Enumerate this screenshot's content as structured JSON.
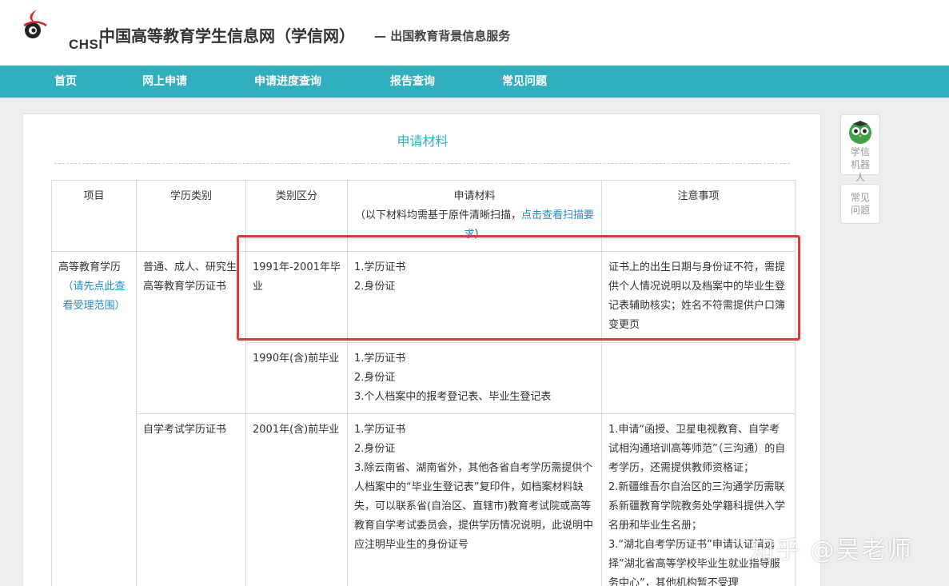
{
  "header": {
    "logo_text": "CHSI",
    "site_title": "中国高等教育学生信息网（学信网）",
    "site_subtitle": "— 出国教育背景信息服务"
  },
  "nav": {
    "items": [
      "首页",
      "网上申请",
      "申请进度查询",
      "报告查询",
      "常见问题"
    ]
  },
  "panel": {
    "title": "申请材料"
  },
  "table": {
    "headers": {
      "project": "项目",
      "category": "学历类别",
      "division": "类别区分",
      "materials": "申请材料",
      "materials_note_prefix": "（以下材料均需基于原件清晰扫描，",
      "materials_note_link": "点击查看扫描要求",
      "materials_note_suffix": "）",
      "notes": "注意事项"
    },
    "project_name": "高等教育学历",
    "project_link": "（请先点此查看受理范围）",
    "rows": [
      {
        "category": "普通、成人、研究生高等教育学历证书",
        "division": "1991年-2001年毕业",
        "materials": [
          "1.学历证书",
          "2.身份证"
        ],
        "notes": "证书上的出生日期与身份证不符，需提供个人情况说明以及档案中的毕业生登记表辅助核实；姓名不符需提供户口簿变更页"
      },
      {
        "division": "1990年(含)前毕业",
        "materials": [
          "1.学历证书",
          "2.身份证",
          "3.个人档案中的报考登记表、毕业生登记表"
        ],
        "notes": ""
      },
      {
        "category": "自学考试学历证书",
        "division": "2001年(含)前毕业",
        "materials": [
          "1.学历证书",
          "2.身份证",
          "3.除云南省、湖南省外，其他各省自考学历需提供个人档案中的“毕业生登记表”复印件，如档案材料缺失，可以联系省(自治区、直辖市)教育考试院或高等教育自学考试委员会，提供学历情况说明，此说明中应注明毕业生的身份证号"
        ],
        "notes": [
          "1.申请“函授、卫星电视教育、自学考试相沟通培训高等师范”（三沟通）的自考学历，还需提供教师资格证；",
          "2.新疆维吾尔自治区的三沟通学历需联系新疆教育学院教务处学籍科提供入学名册和毕业生名册；",
          "3.“湖北自考学历证书”申请认证请选择“湖北省高等学校毕业生就业指导服务中心”，其他机构暂不受理"
        ]
      }
    ]
  },
  "side": {
    "robot_label": "学信机器人",
    "faq_label": "常见问题"
  },
  "watermark": "知乎 @吴老师",
  "colors": {
    "nav": "#31afbe",
    "accent_link": "#1e8fc7",
    "highlight": "#e03a3a",
    "logo_red": "#d6242a"
  }
}
